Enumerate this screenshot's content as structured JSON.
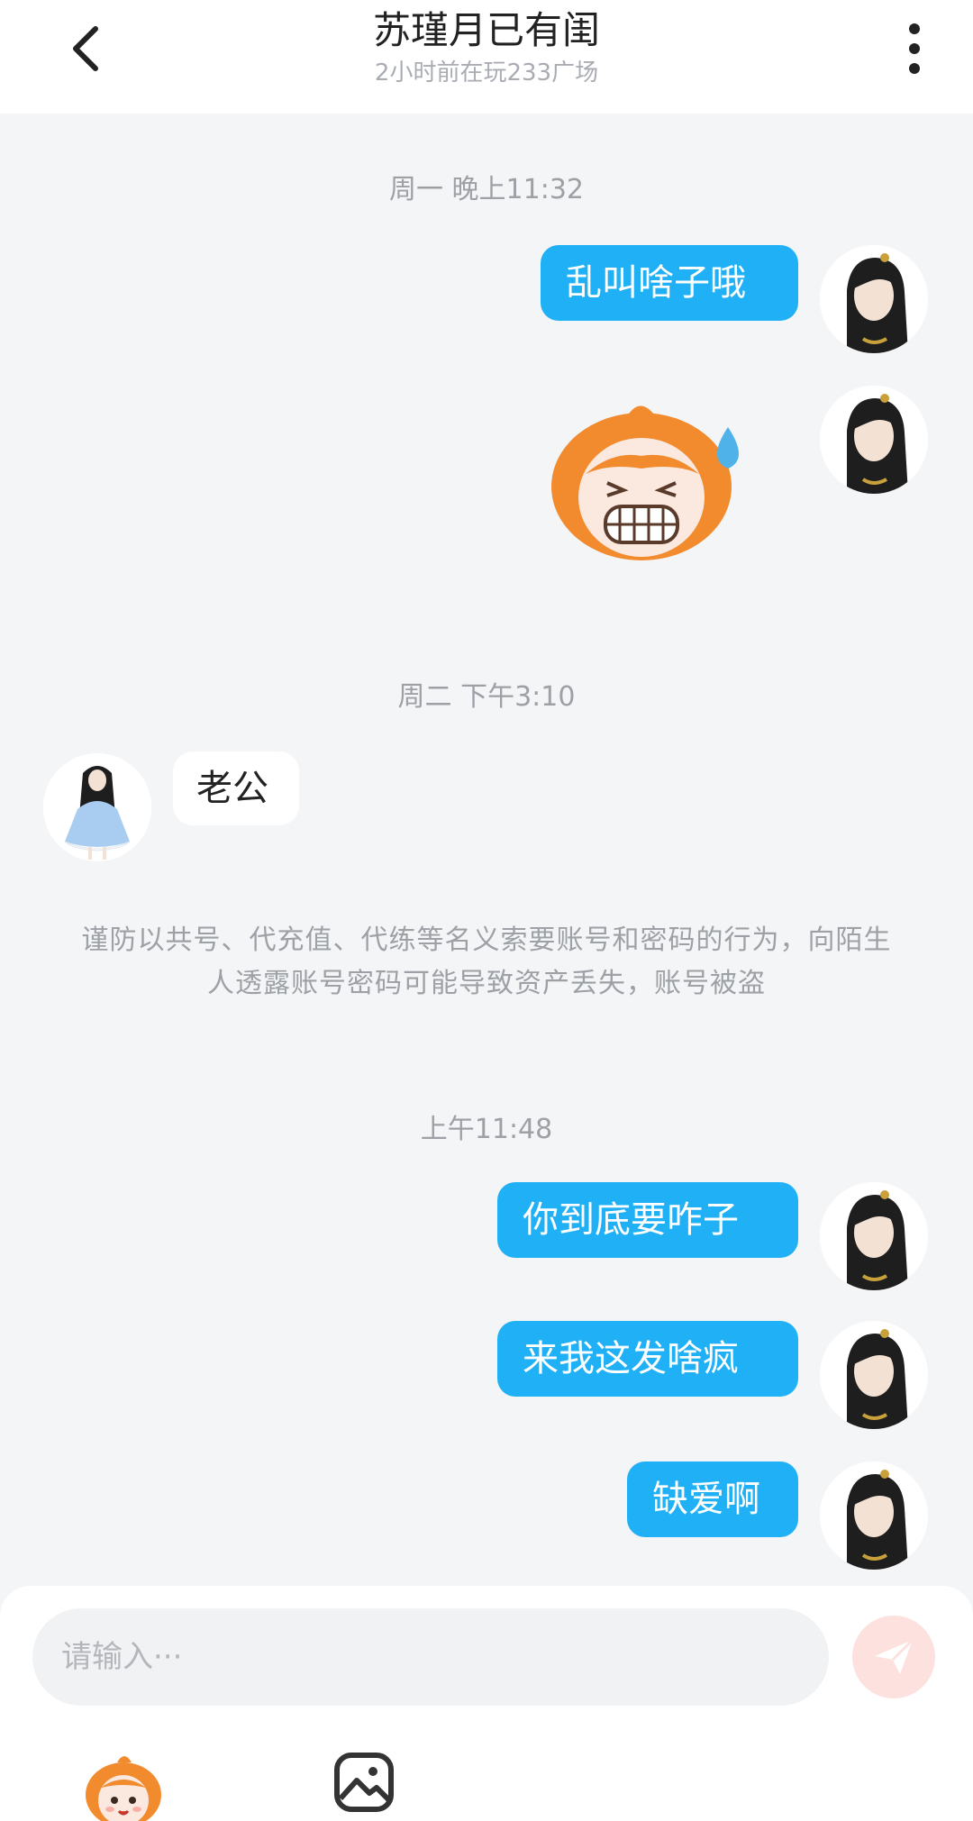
{
  "header": {
    "title": "苏瑾月已有闺",
    "subtitle": "2小时前在玩233广场"
  },
  "messages": {
    "ts1": "周一 晚上11:32",
    "m1": "乱叫啥子哦",
    "ts2": "周二 下午3:10",
    "m2": "老公",
    "notice": "谨防以共号、代充值、代练等名义索要账号和密码的行为，向陌生人透露账号密码可能导致资产丢失，账号被盗",
    "ts3": "上午11:48",
    "m3": "你到底要咋子",
    "m4": "来我这发啥疯",
    "m5": "缺爱啊"
  },
  "composer": {
    "placeholder": "请输入···"
  },
  "icons": {
    "back": "chevron-left-icon",
    "more": "more-vertical-icon",
    "send": "paper-plane-icon",
    "emoji": "mascot-emoji-icon",
    "image": "image-icon"
  },
  "colors": {
    "outgoing_bubble": "#1fb0f5",
    "incoming_bubble": "#ffffff",
    "background": "#f4f5f7",
    "send_button": "#fde1de"
  }
}
